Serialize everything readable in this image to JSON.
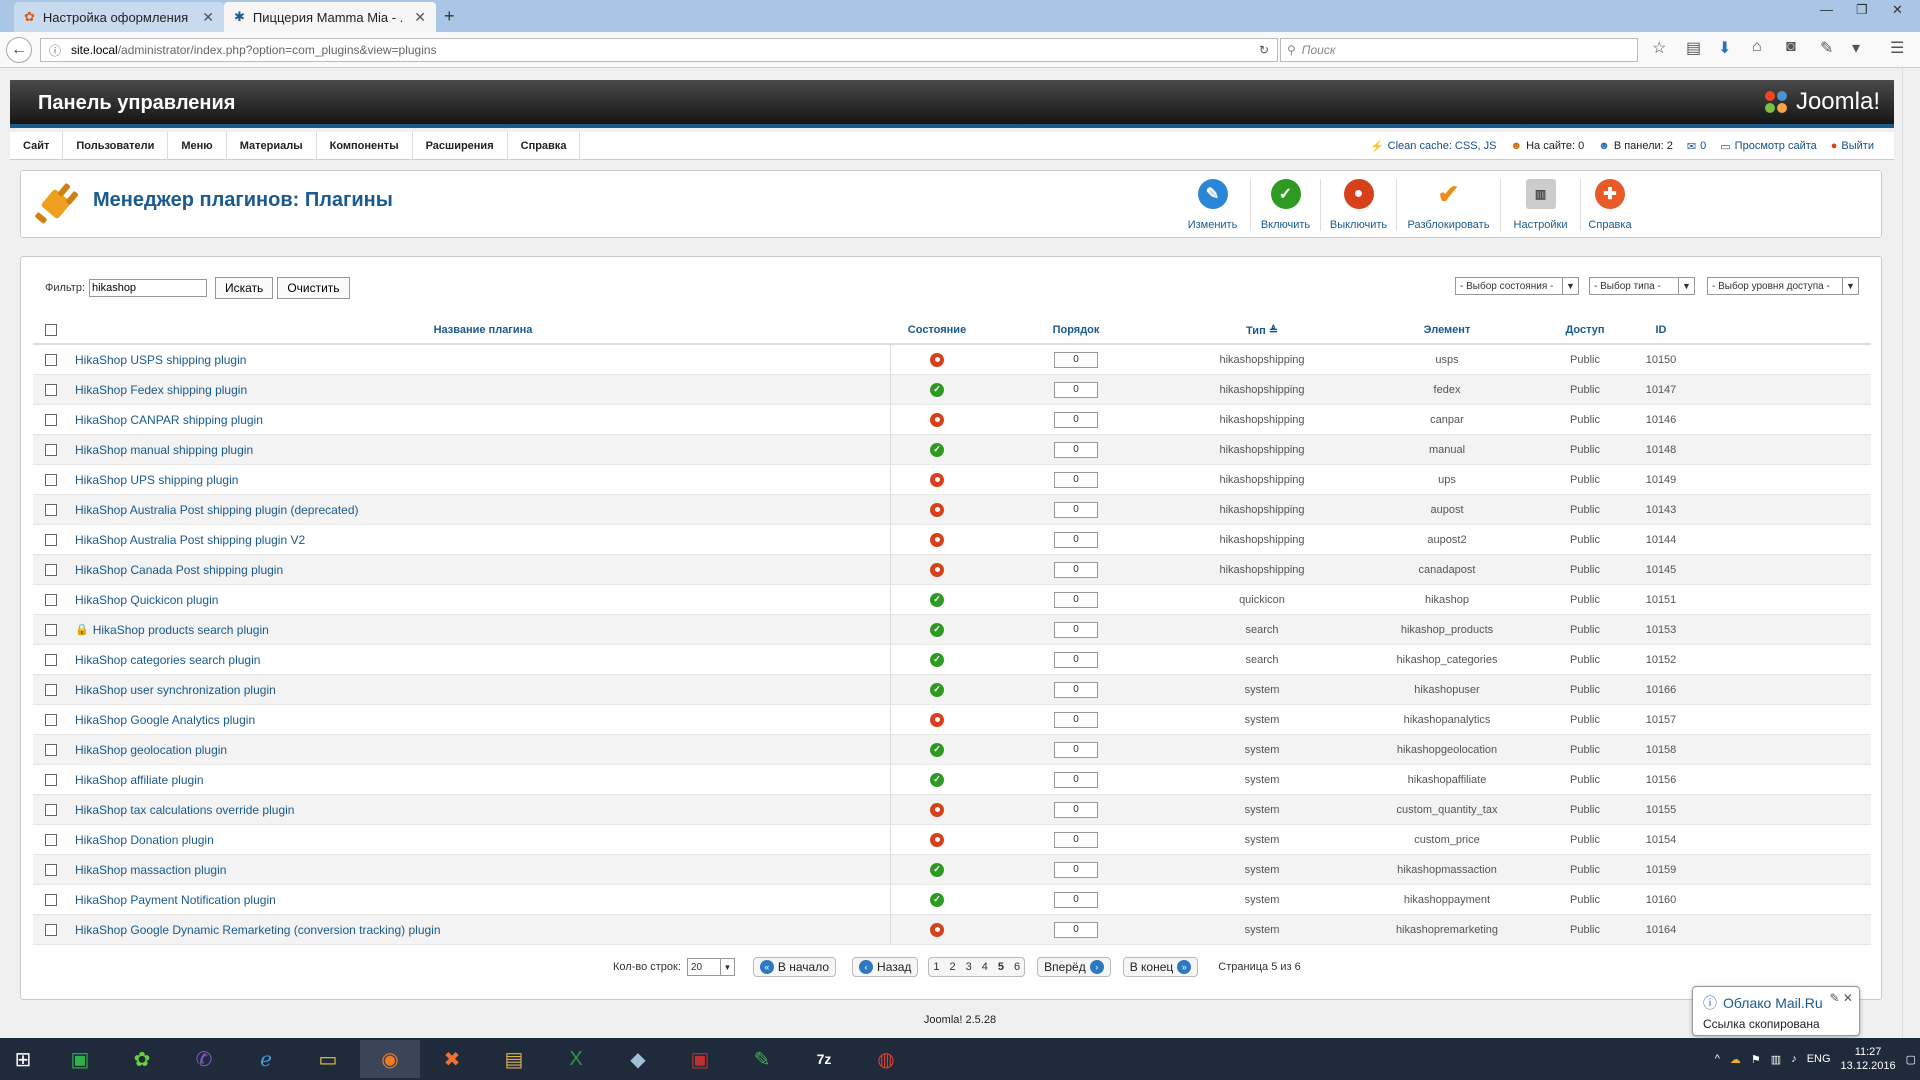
{
  "browser": {
    "tabs": [
      {
        "title": "Настройка оформления ..."
      },
      {
        "title": "Пиццерия Mamma Mia - ..."
      }
    ],
    "new_tab": "+",
    "url_host": "site.local",
    "url_path": "/administrator/index.php?option=com_plugins&view=plugins",
    "search_placeholder": "Поиск"
  },
  "header": {
    "title": "Панель управления",
    "logo_text": "Joomla!"
  },
  "menu": {
    "items": [
      "Сайт",
      "Пользователи",
      "Меню",
      "Материалы",
      "Компоненты",
      "Расширения",
      "Справка"
    ]
  },
  "status": {
    "clean_cache": "Clean cache: CSS, JS",
    "on_site": "На сайте: 0",
    "in_panel": "В панели: 2",
    "messages": "0",
    "view_site": "Просмотр сайта",
    "logout": "Выйти"
  },
  "toolbar": {
    "title": "Менеджер плагинов: Плагины",
    "buttons": [
      "Изменить",
      "Включить",
      "Выключить",
      "Разблокировать",
      "Настройки",
      "Справка"
    ]
  },
  "filter": {
    "label": "Фильтр:",
    "value": "hikashop",
    "search_btn": "Искать",
    "clear_btn": "Очистить",
    "state_select": "- Выбор состояния -",
    "type_select": "- Выбор типа -",
    "access_select": "- Выбор уровня доступа -"
  },
  "table": {
    "headers": [
      "Название плагина",
      "Состояние",
      "Порядок",
      "Тип",
      "Элемент",
      "Доступ",
      "ID"
    ],
    "rows": [
      {
        "name": "HikaShop USPS shipping plugin",
        "enabled": false,
        "order": "0",
        "type": "hikashopshipping",
        "element": "usps",
        "access": "Public",
        "id": "10150"
      },
      {
        "name": "HikaShop Fedex shipping plugin",
        "enabled": true,
        "order": "0",
        "type": "hikashopshipping",
        "element": "fedex",
        "access": "Public",
        "id": "10147"
      },
      {
        "name": "HikaShop CANPAR shipping plugin",
        "enabled": false,
        "order": "0",
        "type": "hikashopshipping",
        "element": "canpar",
        "access": "Public",
        "id": "10146"
      },
      {
        "name": "HikaShop manual shipping plugin",
        "enabled": true,
        "order": "0",
        "type": "hikashopshipping",
        "element": "manual",
        "access": "Public",
        "id": "10148"
      },
      {
        "name": "HikaShop UPS shipping plugin",
        "enabled": false,
        "order": "0",
        "type": "hikashopshipping",
        "element": "ups",
        "access": "Public",
        "id": "10149"
      },
      {
        "name": "HikaShop Australia Post shipping plugin (deprecated)",
        "enabled": false,
        "order": "0",
        "type": "hikashopshipping",
        "element": "aupost",
        "access": "Public",
        "id": "10143"
      },
      {
        "name": "HikaShop Australia Post shipping plugin V2",
        "enabled": false,
        "order": "0",
        "type": "hikashopshipping",
        "element": "aupost2",
        "access": "Public",
        "id": "10144"
      },
      {
        "name": "HikaShop Canada Post shipping plugin",
        "enabled": false,
        "order": "0",
        "type": "hikashopshipping",
        "element": "canadapost",
        "access": "Public",
        "id": "10145"
      },
      {
        "name": "HikaShop Quickicon plugin",
        "enabled": true,
        "order": "0",
        "type": "quickicon",
        "element": "hikashop",
        "access": "Public",
        "id": "10151"
      },
      {
        "name": "HikaShop products search plugin",
        "enabled": true,
        "order": "0",
        "type": "search",
        "element": "hikashop_products",
        "access": "Public",
        "id": "10153",
        "locked": true
      },
      {
        "name": "HikaShop categories search plugin",
        "enabled": true,
        "order": "0",
        "type": "search",
        "element": "hikashop_categories",
        "access": "Public",
        "id": "10152"
      },
      {
        "name": "HikaShop user synchronization plugin",
        "enabled": true,
        "order": "0",
        "type": "system",
        "element": "hikashopuser",
        "access": "Public",
        "id": "10166"
      },
      {
        "name": "HikaShop Google Analytics plugin",
        "enabled": false,
        "order": "0",
        "type": "system",
        "element": "hikashopanalytics",
        "access": "Public",
        "id": "10157"
      },
      {
        "name": "HikaShop geolocation plugin",
        "enabled": true,
        "order": "0",
        "type": "system",
        "element": "hikashopgeolocation",
        "access": "Public",
        "id": "10158"
      },
      {
        "name": "HikaShop affiliate plugin",
        "enabled": true,
        "order": "0",
        "type": "system",
        "element": "hikashopaffiliate",
        "access": "Public",
        "id": "10156"
      },
      {
        "name": "HikaShop tax calculations override plugin",
        "enabled": false,
        "order": "0",
        "type": "system",
        "element": "custom_quantity_tax",
        "access": "Public",
        "id": "10155"
      },
      {
        "name": "HikaShop Donation plugin",
        "enabled": false,
        "order": "0",
        "type": "system",
        "element": "custom_price",
        "access": "Public",
        "id": "10154"
      },
      {
        "name": "HikaShop massaction plugin",
        "enabled": true,
        "order": "0",
        "type": "system",
        "element": "hikashopmassaction",
        "access": "Public",
        "id": "10159"
      },
      {
        "name": "HikaShop Payment Notification plugin",
        "enabled": true,
        "order": "0",
        "type": "system",
        "element": "hikashoppayment",
        "access": "Public",
        "id": "10160"
      },
      {
        "name": "HikaShop Google Dynamic Remarketing (conversion tracking) plugin",
        "enabled": false,
        "order": "0",
        "type": "system",
        "element": "hikashopremarketing",
        "access": "Public",
        "id": "10164"
      }
    ]
  },
  "pagination": {
    "rows_label": "Кол-во строк:",
    "rows_value": "20",
    "start": "В начало",
    "prev": "Назад",
    "pages": [
      "1",
      "2",
      "3",
      "4",
      "5",
      "6"
    ],
    "current_page": "5",
    "next": "Вперёд",
    "end": "В конец",
    "info": "Страница 5 из 6"
  },
  "footer": {
    "version": "Joomla! 2.5.28"
  },
  "notification": {
    "title": "Облако Mail.Ru",
    "body": "Ссылка скопирована"
  },
  "tray": {
    "lang": "ENG",
    "time": "11:27",
    "date": "13.12.2016"
  },
  "colors": {
    "link": "#1a5a8f",
    "enabled": "#2f9a23",
    "disabled": "#d8401c",
    "header_border": "#1c5a8c"
  }
}
